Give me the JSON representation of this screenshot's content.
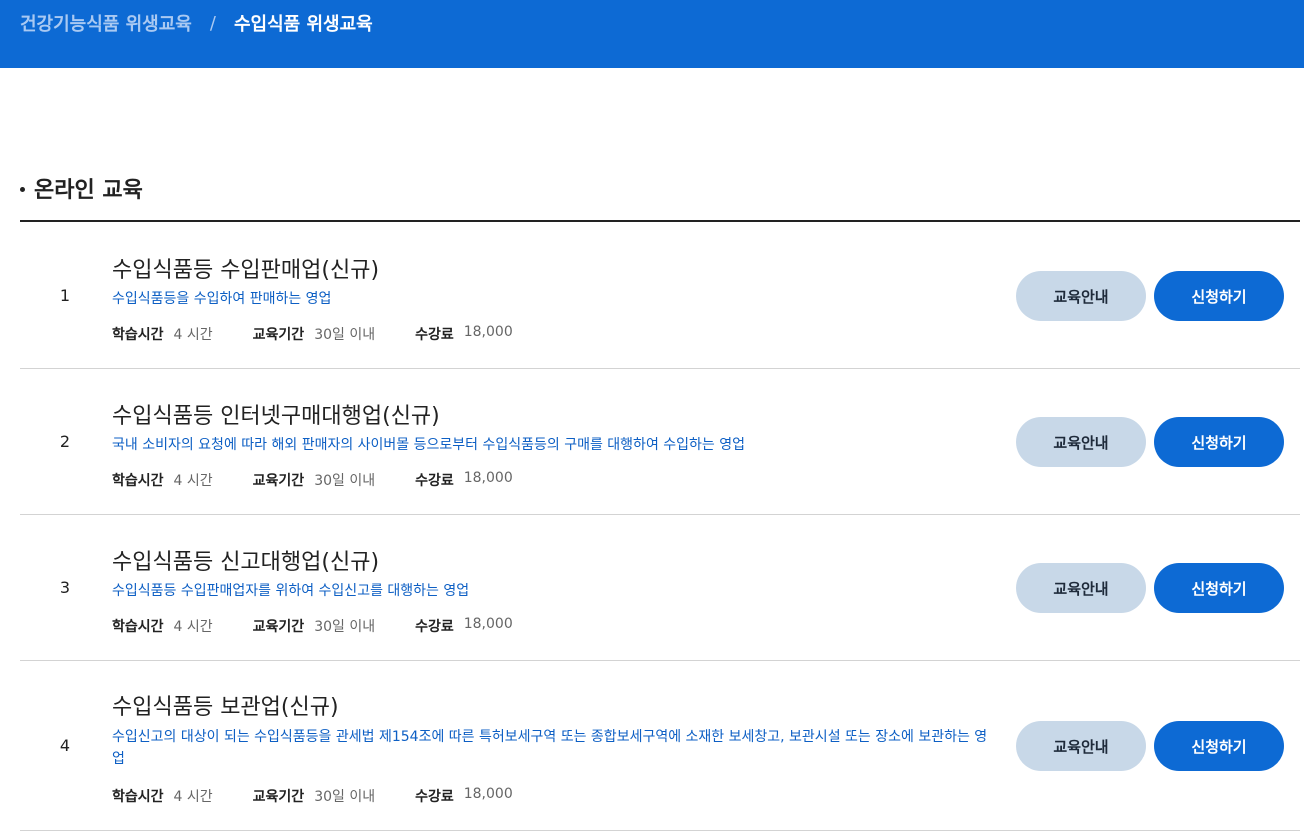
{
  "breadcrumb": {
    "parent": "건강기능식품 위생교육",
    "separator": "/",
    "current": "수입식품 위생교육"
  },
  "section": {
    "title": "온라인 교육"
  },
  "labels": {
    "study_time": "학습시간",
    "period": "교육기간",
    "fee": "수강료",
    "guide_button": "교육안내",
    "apply_button": "신청하기"
  },
  "courses": [
    {
      "num": "1",
      "title": "수입식품등 수입판매업(신규)",
      "desc": "수입식품등을 수입하여 판매하는 영업",
      "study_time": "4 시간",
      "period": "30일 이내",
      "fee": "18,000"
    },
    {
      "num": "2",
      "title": "수입식품등 인터넷구매대행업(신규)",
      "desc": "국내 소비자의 요청에 따라 해외 판매자의 사이버몰 등으로부터 수입식품등의 구매를 대행하여 수입하는 영업",
      "study_time": "4 시간",
      "period": "30일 이내",
      "fee": "18,000"
    },
    {
      "num": "3",
      "title": "수입식품등 신고대행업(신규)",
      "desc": "수입식품등 수입판매업자를 위하여 수입신고를 대행하는 영업",
      "study_time": "4 시간",
      "period": "30일 이내",
      "fee": "18,000"
    },
    {
      "num": "4",
      "title": "수입식품등 보관업(신규)",
      "desc": "수입신고의 대상이 되는 수입식품등을 관세법 제154조에 따른 특허보세구역 또는 종합보세구역에 소재한 보세창고, 보관시설 또는 장소에 보관하는 영업",
      "study_time": "4 시간",
      "period": "30일 이내",
      "fee": "18,000"
    }
  ],
  "colors": {
    "header_bg": "#0d6ad4",
    "desc_text": "#0d5fc4",
    "guide_button_bg": "#c8d8e8",
    "apply_button_bg": "#0d6ad4"
  }
}
